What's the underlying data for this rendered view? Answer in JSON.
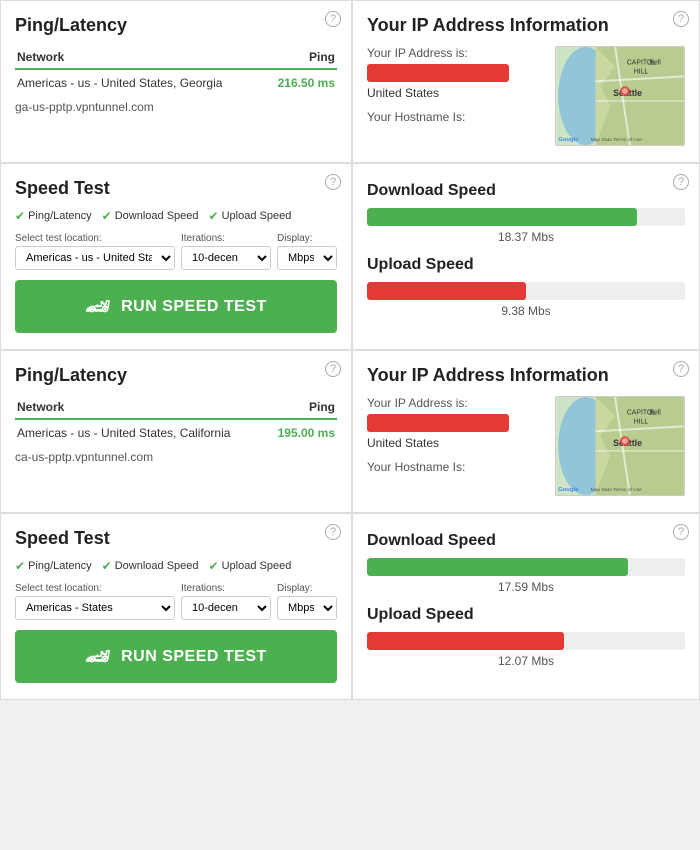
{
  "sections": [
    {
      "row": 1,
      "left": {
        "type": "ping",
        "title": "Ping/Latency",
        "col_network": "Network",
        "col_ping": "Ping",
        "network": "Americas - us - United States, Georgia",
        "ping": "216.50 ms",
        "hostname": "ga-us-pptp.vpntunnel.com"
      },
      "right": {
        "type": "ip",
        "title": "Your IP Address Information",
        "ip_label": "Your IP Address is:",
        "ip_value": "REDACTED",
        "country": "United States",
        "hostname_label": "Your Hostname Is:"
      }
    },
    {
      "row": 2,
      "left": {
        "type": "speed",
        "title": "Speed Test",
        "checks": [
          "Ping/Latency",
          "Download Speed",
          "Upload Speed"
        ],
        "select_location_label": "Select test location:",
        "select_location_value": "Americas - us - United States, (",
        "iterations_label": "Iterations:",
        "iterations_value": "10-decen",
        "display_label": "Display:",
        "display_value": "Mbps",
        "btn_label": "RUN SPEED TEST"
      },
      "right": {
        "type": "speeds",
        "download_label": "Download Speed",
        "download_value": "18.37 Mbs",
        "download_pct": 85,
        "upload_label": "Upload Speed",
        "upload_value": "9.38 Mbs",
        "upload_pct": 50
      }
    },
    {
      "row": 3,
      "left": {
        "type": "ping",
        "title": "Ping/Latency",
        "col_network": "Network",
        "col_ping": "Ping",
        "network": "Americas - us - United States, California",
        "ping": "195.00 ms",
        "hostname": "ca-us-pptp.vpntunnel.com"
      },
      "right": {
        "type": "ip",
        "title": "Your IP Address Information",
        "ip_label": "Your IP Address is:",
        "ip_value": "REDACTED",
        "country": "United States",
        "hostname_label": "Your Hostname Is:"
      }
    },
    {
      "row": 4,
      "left": {
        "type": "speed",
        "title": "Speed Test",
        "checks": [
          "Ping/Latency",
          "Download Speed",
          "Upload Speed"
        ],
        "select_location_label": "Select test location:",
        "select_location_value": "Americas - States",
        "iterations_label": "Iterations:",
        "iterations_value": "10-decen",
        "display_label": "Display:",
        "display_value": "Mbps",
        "btn_label": "RUN SPEED TEST"
      },
      "right": {
        "type": "speeds",
        "download_label": "Download Speed",
        "download_value": "17.59 Mbs",
        "download_pct": 82,
        "upload_label": "Upload Speed",
        "upload_value": "12.07 Mbs",
        "upload_pct": 62
      }
    }
  ],
  "map": {
    "seattle_label": "Seattle",
    "google_label": "Google",
    "map_data_label": "Map Data  Terms of Use"
  }
}
